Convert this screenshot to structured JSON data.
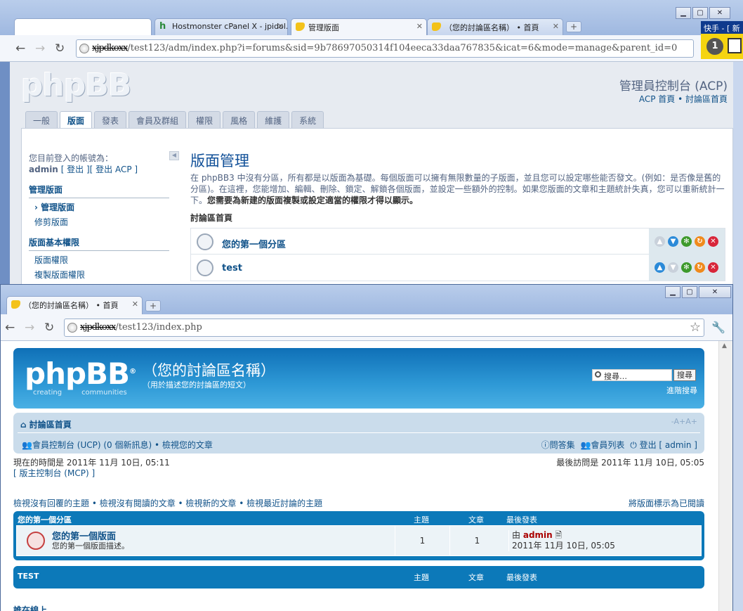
{
  "back_window": {
    "tabs": [
      {
        "label": ""
      },
      {
        "label": "Hostmonster cPanel X - jpidol.c"
      },
      {
        "label": "管理版面"
      },
      {
        "label": "（您的討論區名稱） • 首頁"
      }
    ],
    "url_prefix": "xjpdkoxx",
    "url": "/test123/adm/index.php?i=forums&sid=9b78697050314f104eeca33daa767835&icat=6&mode=manage&parent_id=0",
    "acp": {
      "title": "管理員控制台 (ACP)",
      "links": "ACP 首頁 • 討論區首頁",
      "tabs": [
        "一般",
        "版面",
        "發表",
        "會員及群組",
        "權限",
        "風格",
        "維護",
        "系統"
      ],
      "logged_in_label": "您目前登入的帳號為：",
      "logged_in_user": "admin",
      "logged_in_links": "[ 登出 ][ 登出 ACP ]",
      "section1": "管理版面",
      "section1_items": [
        "管理版面",
        "修剪版面"
      ],
      "section2": "版面基本權限",
      "section2_items": [
        "版面權限",
        "複製版面權限"
      ],
      "heading": "版面管理",
      "description": "在 phpBB3 中沒有分區，所有都是以版面為基礎。每個版面可以擁有無限數量的子版面，並且您可以設定哪些能否發文。(例如：是否像是舊的分區)。在這裡，您能增加、編輯、刪除、鎖定、解鎖各個版面，並設定一些額外的控制。如果您版面的文章和主題統計失真，您可以重新統計一下。",
      "description_bold": "您需要為新建的版面複製或設定適當的權限才得以顯示。",
      "board_index": "討論區首頁",
      "forums": [
        "您的第一個分區",
        "test"
      ]
    },
    "quick_panel": {
      "title": "快手 - [ 新",
      "number": "1"
    }
  },
  "front_window": {
    "tab": "（您的討論區名稱） • 首頁",
    "url_prefix": "xjpdkoxx",
    "url": "/test123/index.php",
    "header": {
      "logo": "phpBB",
      "logo_mark": "®",
      "tagline_left": "creating",
      "tagline_right": "communities",
      "site_name": "（您的討論區名稱）",
      "site_desc": "（用於描述您的討論區的短文）",
      "search_placeholder": "搜尋…",
      "search_button": "搜尋",
      "advanced_search": "進階搜尋"
    },
    "navbar": {
      "crumb": "討論區首頁",
      "font_size": "-A+A+",
      "ucp": "會員控制台 (UCP) (0 個新訊息) • 檢視您的文章",
      "faq": "問答集",
      "members": "會員列表",
      "logout": "登出 [ admin ]"
    },
    "current_time": "現在的時間是 2011年 11月 10日, 05:11",
    "mcp": "[ 版主控制台 (MCP) ]",
    "last_visit": "最後訪問是 2011年 11月 10日, 05:05",
    "search_links": "檢視沒有回覆的主題 • 檢視沒有閱讀的文章 • 檢視新的文章 • 檢視最近討論的主題",
    "mark_read": "將版面標示為已閱讀",
    "categories": [
      {
        "name": "您的第一個分區",
        "col_topics": "主題",
        "col_posts": "文章",
        "col_last": "最後發表",
        "forums": [
          {
            "name": "您的第一個版面",
            "desc": "您的第一個版面描述。",
            "topics": "1",
            "posts": "1",
            "by": "由",
            "author": "admin",
            "date": "2011年 11月 10日, 05:05"
          }
        ]
      },
      {
        "name": "TEST",
        "col_topics": "主題",
        "col_posts": "文章",
        "col_last": "最後發表"
      }
    ],
    "who_online": "誰在線上"
  }
}
